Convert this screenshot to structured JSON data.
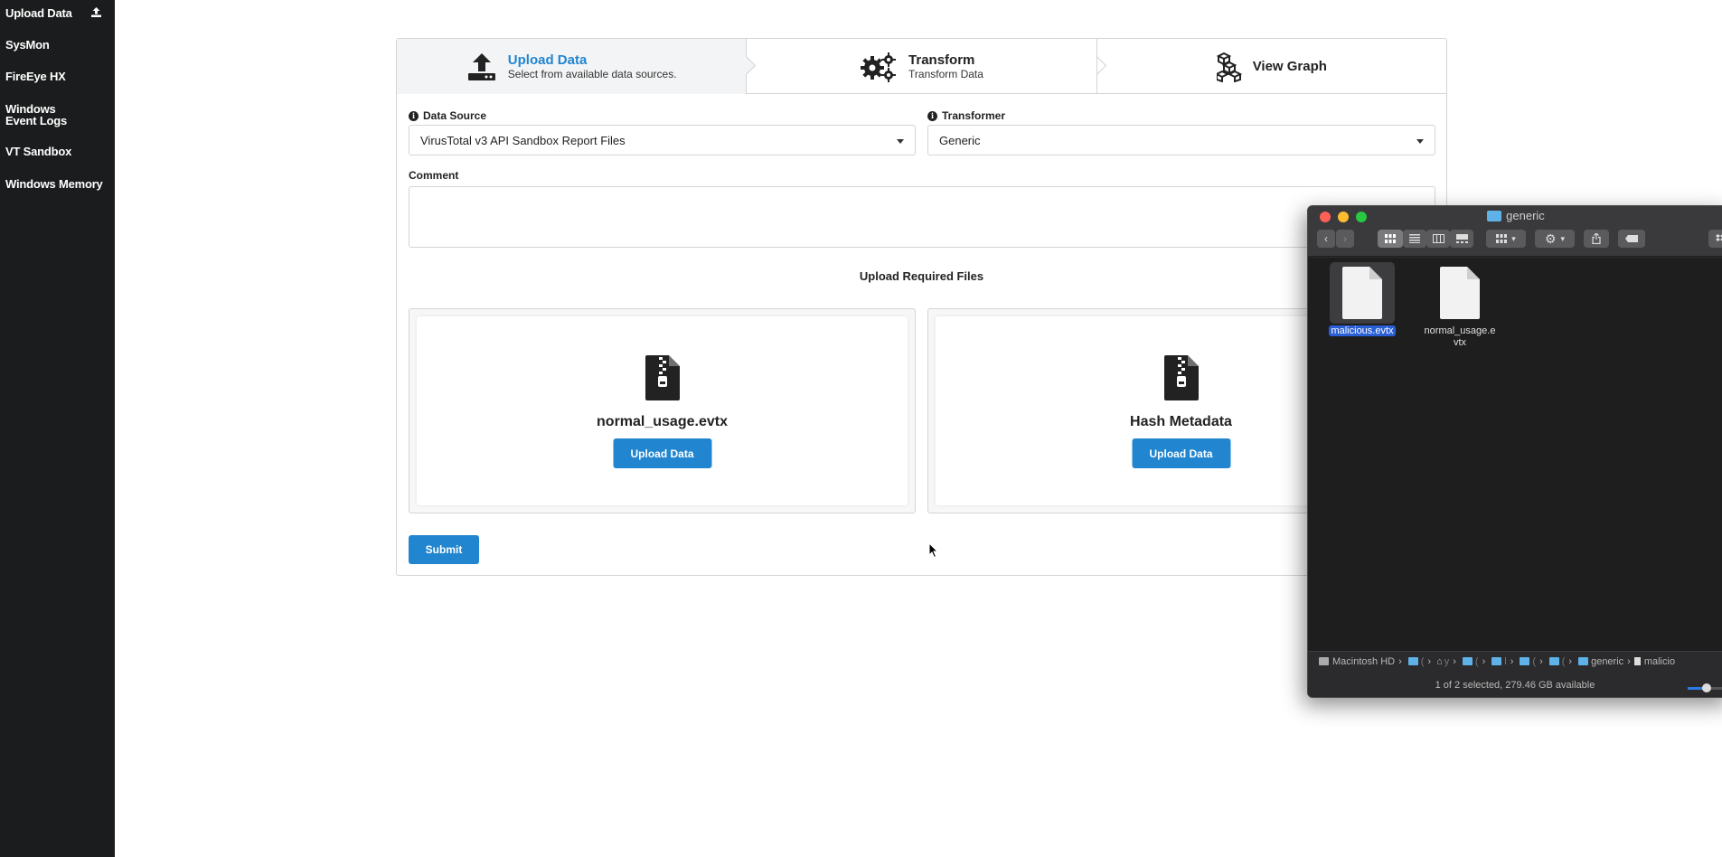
{
  "sidebar": {
    "items": [
      {
        "label": "Upload Data",
        "icon": "upload-icon"
      },
      {
        "label": "SysMon"
      },
      {
        "label": "FireEye HX"
      },
      {
        "label": "Windows Event Logs"
      },
      {
        "label": "VT Sandbox"
      },
      {
        "label": "Windows Memory"
      }
    ]
  },
  "steps": [
    {
      "title": "Upload Data",
      "desc": "Select from available data sources.",
      "icon": "upload-icon",
      "active": true
    },
    {
      "title": "Transform",
      "desc": "Transform Data",
      "icon": "gears-icon"
    },
    {
      "title": "View Graph",
      "desc": "",
      "icon": "cubes-icon"
    }
  ],
  "form": {
    "data_source_label": "Data Source",
    "data_source_value": "VirusTotal v3 API Sandbox Report Files",
    "transformer_label": "Transformer",
    "transformer_value": "Generic",
    "comment_label": "Comment",
    "comment_value": "",
    "section_title": "Upload Required Files",
    "uploads": [
      {
        "name": "normal_usage.evtx",
        "button": "Upload Data",
        "icon": "file-zip-icon"
      },
      {
        "name": "Hash Metadata",
        "button": "Upload Data",
        "icon": "file-zip-icon"
      }
    ],
    "submit_label": "Submit"
  },
  "finder": {
    "title": "generic",
    "files": [
      {
        "name": "malicious.evtx",
        "selected": true
      },
      {
        "name": "normal_usage.evtx",
        "selected": false
      }
    ],
    "path": {
      "root": "Macintosh HD",
      "short_segments": [
        "(",
        "y",
        "(",
        "l",
        "(",
        "("
      ],
      "folder": "generic",
      "file": "malicio"
    },
    "status": "1 of 2 selected, 279.46 GB available"
  },
  "colors": {
    "accent": "#2185d0",
    "sidebar_bg": "#1b1c1d",
    "finder_bg": "#1e1e1f",
    "selection": "#2a5fd6"
  }
}
